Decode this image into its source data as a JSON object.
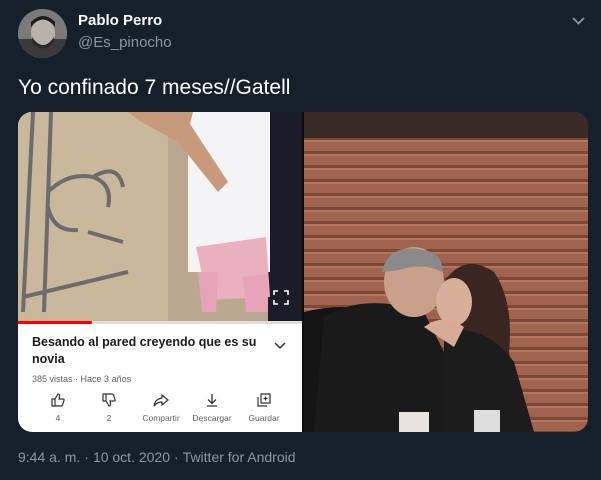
{
  "tweet": {
    "author_name": "Pablo Perro",
    "author_handle": "@Es_pinocho",
    "text": "Yo confinado 7 meses//Gatell",
    "time": "9:44 a. m.",
    "date": "10 oct. 2020",
    "source": "Twitter for Android"
  },
  "video_card": {
    "title": "Besando al pared creyendo que es su novia",
    "views": "385 vistas",
    "age": "Hace 3 años",
    "progress_fraction": 0.26,
    "actions": [
      {
        "icon": "thumb-up-icon",
        "label": "4"
      },
      {
        "icon": "thumb-down-icon",
        "label": "2"
      },
      {
        "icon": "share-icon",
        "label": "Compartir"
      },
      {
        "icon": "download-icon",
        "label": "Descargar"
      },
      {
        "icon": "save-icon",
        "label": "Guardar"
      }
    ]
  },
  "colors": {
    "background": "#15202b",
    "secondary_text": "#8899a6",
    "progress_red": "#ff0000"
  }
}
